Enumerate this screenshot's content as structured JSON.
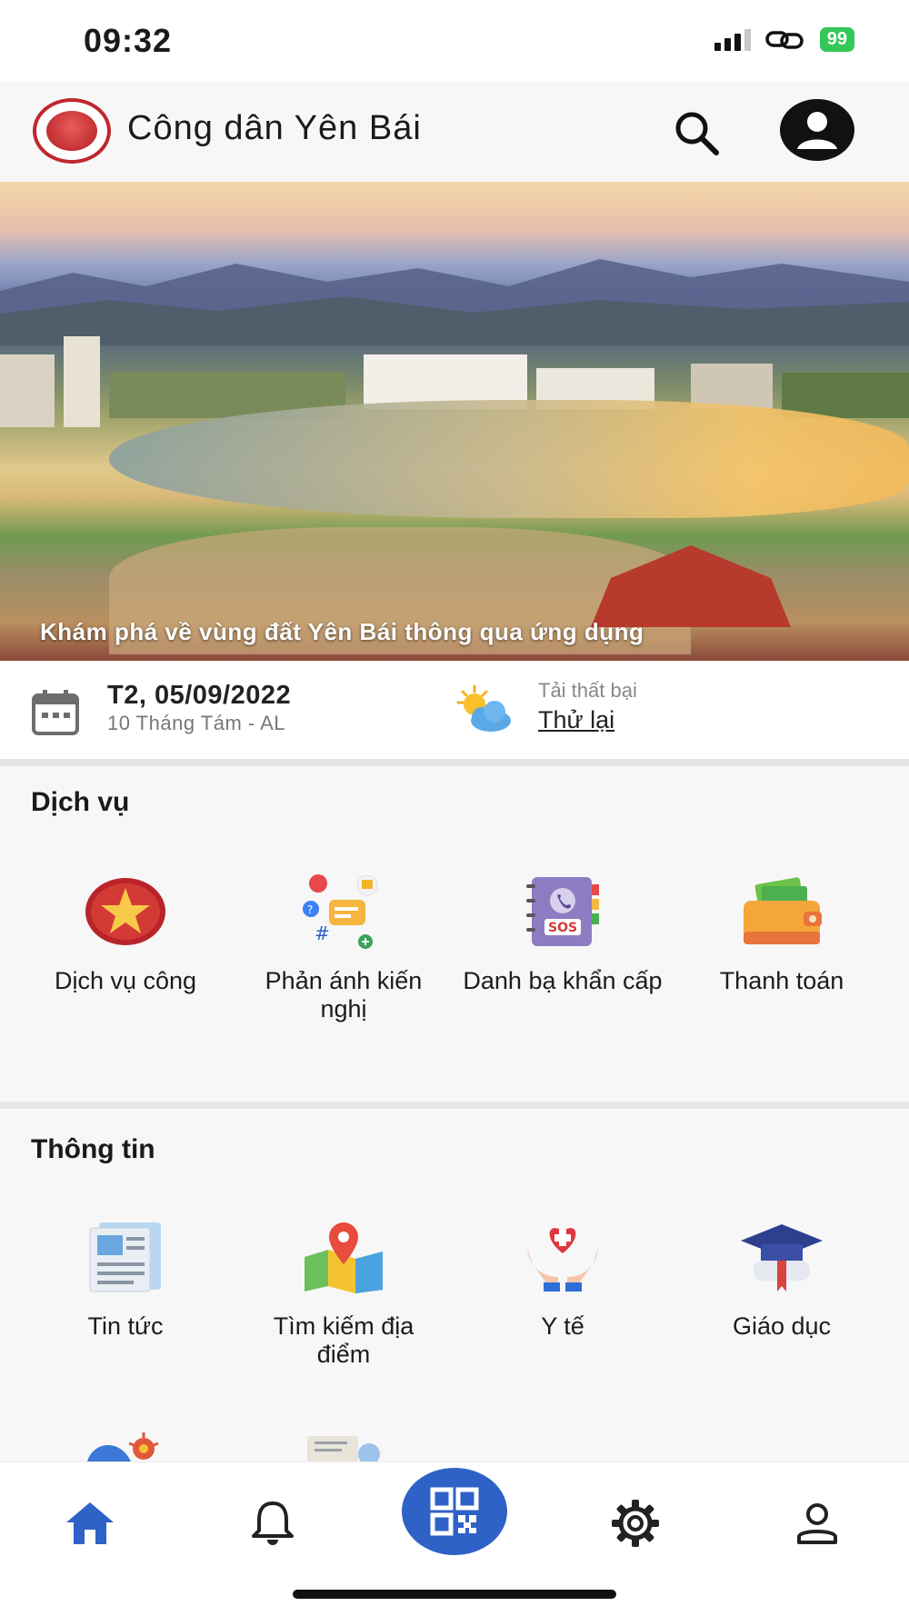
{
  "status_bar": {
    "time": "09:32",
    "battery": "99"
  },
  "header": {
    "app_title": "Công dân Yên Bái",
    "logo_icon": "yen-bai-emblem",
    "search_icon": "search-icon",
    "account_icon": "account-circle-icon"
  },
  "banner": {
    "caption": "Khám phá về vùng đất Yên Bái thông qua ứng dụng"
  },
  "date_weather": {
    "date": "T2, 05/09/2022",
    "lunar": "10 Tháng Tám - AL",
    "weather_status": "Tải thất bại",
    "retry": "Thử lại"
  },
  "services": {
    "title": "Dịch vụ",
    "items": [
      {
        "label": "Dịch vụ công",
        "icon": "national-emblem-icon"
      },
      {
        "label": "Phản ánh kiến nghị",
        "icon": "feedback-chat-icon"
      },
      {
        "label": "Danh bạ khẩn cấp",
        "icon": "sos-phonebook-icon"
      },
      {
        "label": "Thanh toán",
        "icon": "wallet-icon"
      }
    ]
  },
  "information": {
    "title": "Thông tin",
    "items": [
      {
        "label": "Tin tức",
        "icon": "newspaper-icon"
      },
      {
        "label": "Tìm kiếm địa điểm",
        "icon": "map-pin-icon"
      },
      {
        "label": "Y tế",
        "icon": "health-heart-hands-icon"
      },
      {
        "label": "Giáo dục",
        "icon": "graduation-cap-icon"
      }
    ]
  },
  "bottom_nav": {
    "items": [
      {
        "name": "home",
        "icon": "home-icon",
        "active": true
      },
      {
        "name": "notifications",
        "icon": "bell-icon"
      },
      {
        "name": "qr",
        "icon": "qr-code-icon"
      },
      {
        "name": "settings",
        "icon": "gear-icon"
      },
      {
        "name": "profile",
        "icon": "person-icon"
      }
    ]
  },
  "colors": {
    "accent": "#2f62c7",
    "battery": "#34c759",
    "emblem_red": "#c0262d"
  }
}
